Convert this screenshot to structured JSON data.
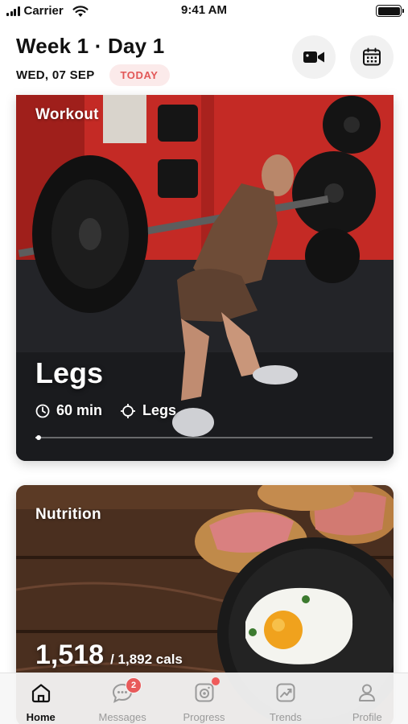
{
  "status_bar": {
    "carrier": "Carrier",
    "time": "9:41 AM",
    "icons": [
      "signal-icon",
      "wifi-icon",
      "battery-icon"
    ]
  },
  "header": {
    "title": "Week 1 · Day 1",
    "date": "WED, 07 SEP",
    "today_label": "TODAY",
    "actions": [
      "video-camera-icon",
      "calendar-icon"
    ]
  },
  "workout_card": {
    "label": "Workout",
    "name": "Legs",
    "duration": "60 min",
    "focus": "Legs",
    "progress": 0.01,
    "icons": [
      "clock-icon",
      "target-icon"
    ]
  },
  "nutrition_card": {
    "label": "Nutrition",
    "calories": "1,518",
    "calories_target": "/ 1,892 cals"
  },
  "tab_bar": {
    "tabs": [
      {
        "label": "Home",
        "icon": "home-icon",
        "active": true
      },
      {
        "label": "Messages",
        "icon": "chat-icon",
        "badge": "2"
      },
      {
        "label": "Progress",
        "icon": "progress-camera-icon",
        "dot": true
      },
      {
        "label": "Trends",
        "icon": "trends-icon"
      },
      {
        "label": "Profile",
        "icon": "profile-icon"
      }
    ]
  },
  "colors": {
    "accent": "#e25757",
    "badge_bg": "#fbeaea",
    "notification": "#e85a5a",
    "inactive_tab": "#9a9a9a"
  }
}
